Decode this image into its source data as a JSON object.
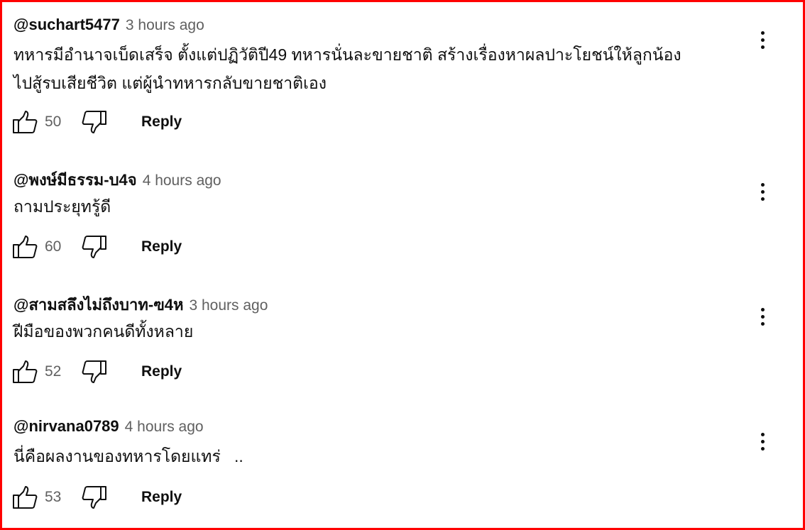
{
  "comments": [
    {
      "author": "@suchart5477",
      "time": "3 hours ago",
      "text": "ทหารมีอำนาจเบ็ดเสร็จ ตั้งแต่ปฏิวัติปี49 ทหารนั่นละขายชาติ สร้างเรื่องหาผลปาะโยชน์ให้ลูกน้อง\nไปสู้รบเสียชีวิต แต่ผู้นำทหารกลับขายชาติเอง",
      "likes": "50",
      "reply_label": "Reply"
    },
    {
      "author": "@พงษ์มีธรรม-บ4จ",
      "time": "4 hours ago",
      "text": "ถามประยุทรู้ดี",
      "likes": "60",
      "reply_label": "Reply"
    },
    {
      "author": "@สามสลึงไม่ถึงบาท-ฃ4ห",
      "time": "3 hours ago",
      "text": "ฝีมือของพวกคนดีทั้งหลาย",
      "likes": "52",
      "reply_label": "Reply"
    },
    {
      "author": "@nirvana0789",
      "time": "4 hours ago",
      "text": "นี่คือผลงานของทหารโดยแทร่   ..",
      "likes": "53",
      "reply_label": "Reply"
    }
  ],
  "icons": {
    "like": "thumbs-up-icon",
    "dislike": "thumbs-down-icon",
    "more": "more-vertical-icon"
  },
  "colors": {
    "frame": "#ff0000",
    "text": "#0f0f0f",
    "secondary": "#606060"
  }
}
